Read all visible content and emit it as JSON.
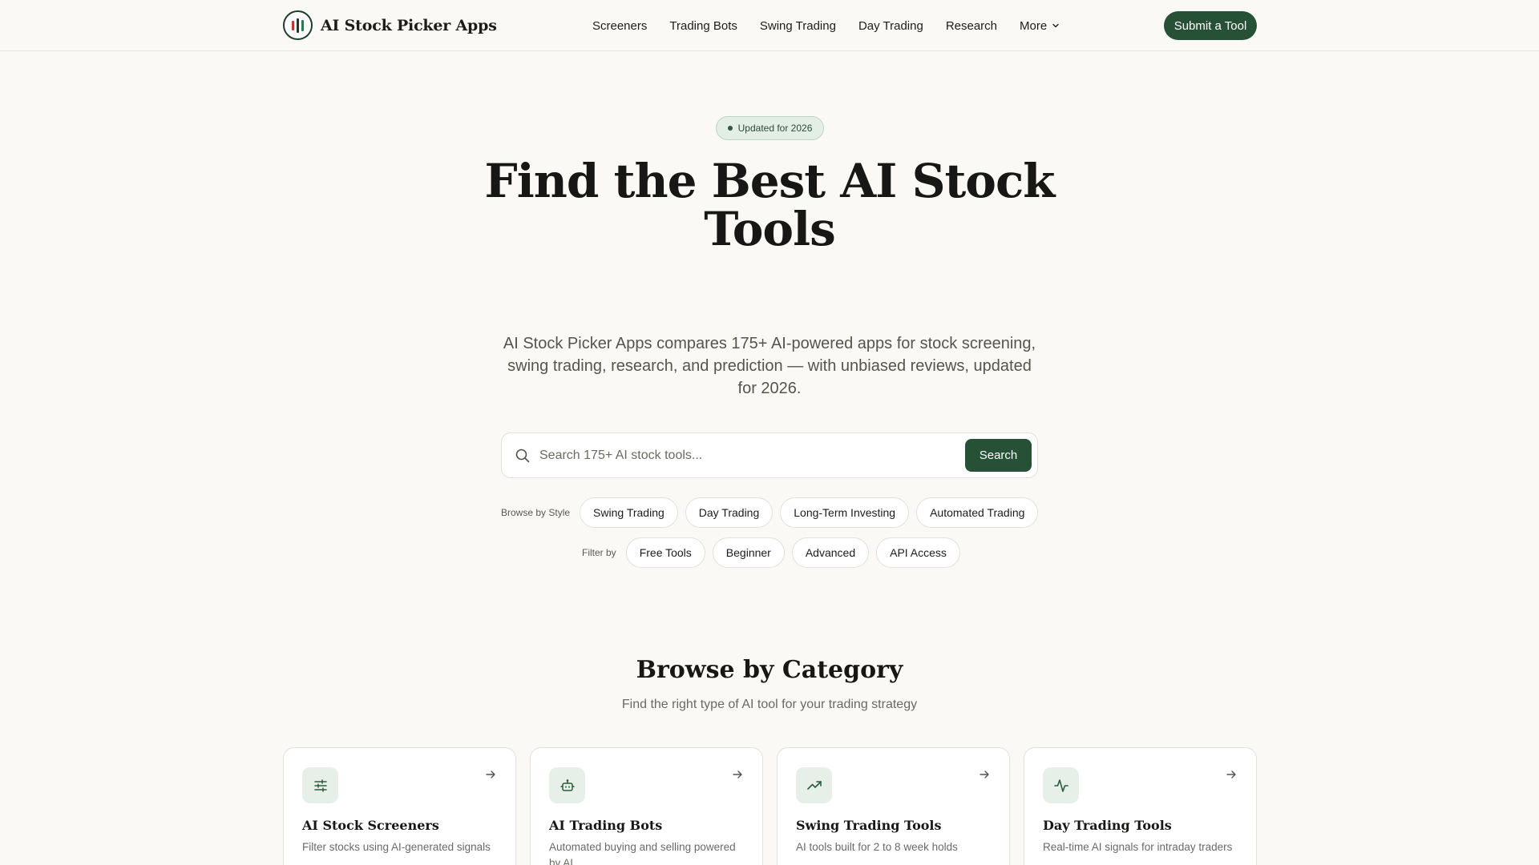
{
  "brand": {
    "name": "AI Stock Picker Apps"
  },
  "nav": {
    "items": [
      "Screeners",
      "Trading Bots",
      "Swing Trading",
      "Day Trading",
      "Research"
    ],
    "more_label": "More",
    "submit_label": "Submit a Tool"
  },
  "hero": {
    "badge": "Updated for 2026",
    "title_line1": "Find the Best AI Stock",
    "title_line2": "Tools",
    "subtitle": "AI Stock Picker Apps compares 175+ AI-powered apps for stock screening, swing trading, research, and prediction — with unbiased reviews, updated for 2026."
  },
  "search": {
    "placeholder": "Search 175+ AI stock tools...",
    "value": "",
    "button_label": "Search"
  },
  "browse_style": {
    "label": "Browse by Style",
    "chips": [
      "Swing Trading",
      "Day Trading",
      "Long-Term Investing",
      "Automated Trading"
    ]
  },
  "filter": {
    "label": "Filter by",
    "chips": [
      "Free Tools",
      "Beginner",
      "Advanced",
      "API Access"
    ]
  },
  "categories": {
    "title": "Browse by Category",
    "subtitle": "Find the right type of AI tool for your trading strategy",
    "cards": [
      {
        "title": "AI Stock Screeners",
        "desc": "Filter stocks using AI-generated signals",
        "icon": "sliders-icon"
      },
      {
        "title": "AI Trading Bots",
        "desc": "Automated buying and selling powered by AI",
        "icon": "robot-icon"
      },
      {
        "title": "Swing Trading Tools",
        "desc": "AI tools built for 2 to 8 week holds",
        "icon": "trending-up-icon"
      },
      {
        "title": "Day Trading Tools",
        "desc": "Real-time AI signals for intraday traders",
        "icon": "activity-icon"
      }
    ]
  },
  "colors": {
    "accent": "#275137",
    "background": "#faf9f5",
    "badge_bg": "#e3efe4",
    "logo_red": "#c0392b",
    "logo_green": "#2d7a4a"
  }
}
